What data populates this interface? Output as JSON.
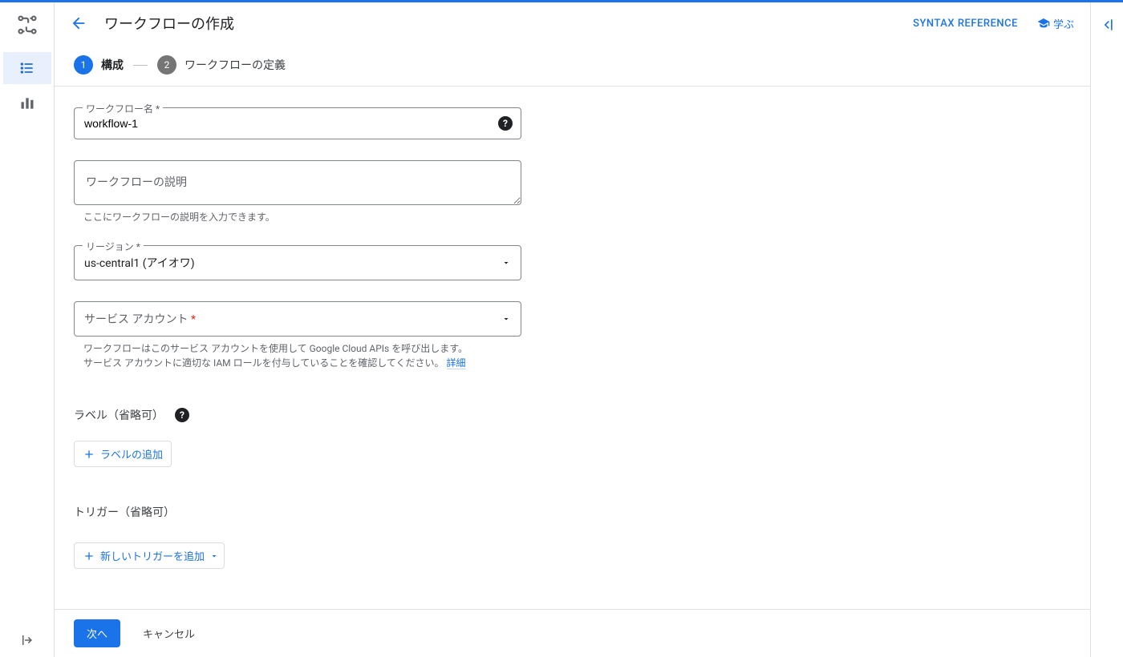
{
  "header": {
    "title": "ワークフローの作成",
    "syntax_ref": "Syntax reference",
    "learn": "学ぶ"
  },
  "stepper": {
    "step1_num": "1",
    "step1_label": "構成",
    "step2_num": "2",
    "step2_label": "ワークフローの定義"
  },
  "form": {
    "name_label": "ワークフロー名 *",
    "name_value": "workflow-1",
    "desc_placeholder": "ワークフローの説明",
    "desc_hint": "ここにワークフローの説明を入力できます。",
    "region_label": "リージョン *",
    "region_value": "us-central1 (アイオワ)",
    "service_account_label": "サービス アカウント",
    "service_account_hint_1": "ワークフローはこのサービス アカウントを使用して Google Cloud APIs を呼び出します。",
    "service_account_hint_2": "サービス アカウントに適切な IAM ロールを付与していることを確認してください。 ",
    "service_account_hint_link": "詳細",
    "labels_section": "ラベル（省略可）",
    "add_label": "ラベルの追加",
    "triggers_section": "トリガー（省略可）",
    "add_trigger": "新しいトリガーを追加"
  },
  "footer": {
    "next": "次へ",
    "cancel": "キャンセル"
  }
}
